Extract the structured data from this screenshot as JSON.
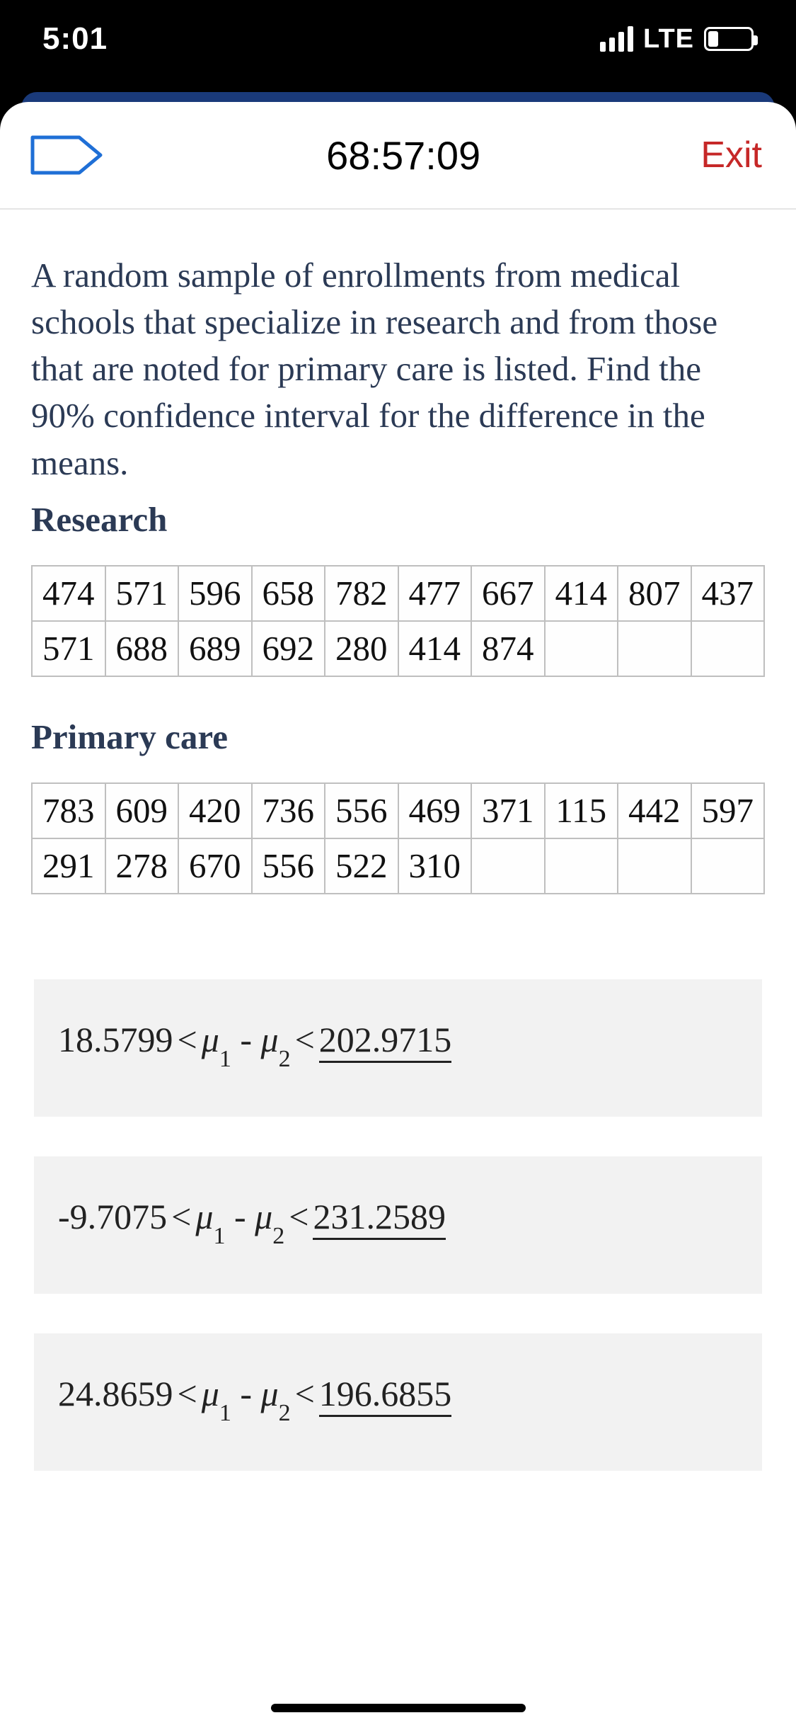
{
  "status_bar": {
    "time": "5:01",
    "network_label": "LTE"
  },
  "toolbar": {
    "timer": "68:57:09",
    "exit_label": "Exit"
  },
  "question": {
    "prompt": "A random sample of enrollments from medical schools that specialize in research and from those that are noted for primary care is listed. Find the 90% confidence interval for the difference in the means.",
    "section1_label": "Research",
    "section2_label": "Primary care",
    "research_data": {
      "row1": [
        "474",
        "571",
        "596",
        "658",
        "782",
        "477",
        "667",
        "414",
        "807",
        "437"
      ],
      "row2": [
        "571",
        "688",
        "689",
        "692",
        "280",
        "414",
        "874",
        "",
        "",
        ""
      ]
    },
    "primary_data": {
      "row1": [
        "783",
        "609",
        "420",
        "736",
        "556",
        "469",
        "371",
        "115",
        "442",
        "597"
      ],
      "row2": [
        "291",
        "278",
        "670",
        "556",
        "522",
        "310",
        "",
        "",
        "",
        ""
      ]
    }
  },
  "answers": [
    {
      "lower": "18.5799",
      "upper": "202.9715"
    },
    {
      "lower": "-9.7075",
      "upper": "231.2589"
    },
    {
      "lower": "24.8659",
      "upper": "196.6855"
    }
  ]
}
